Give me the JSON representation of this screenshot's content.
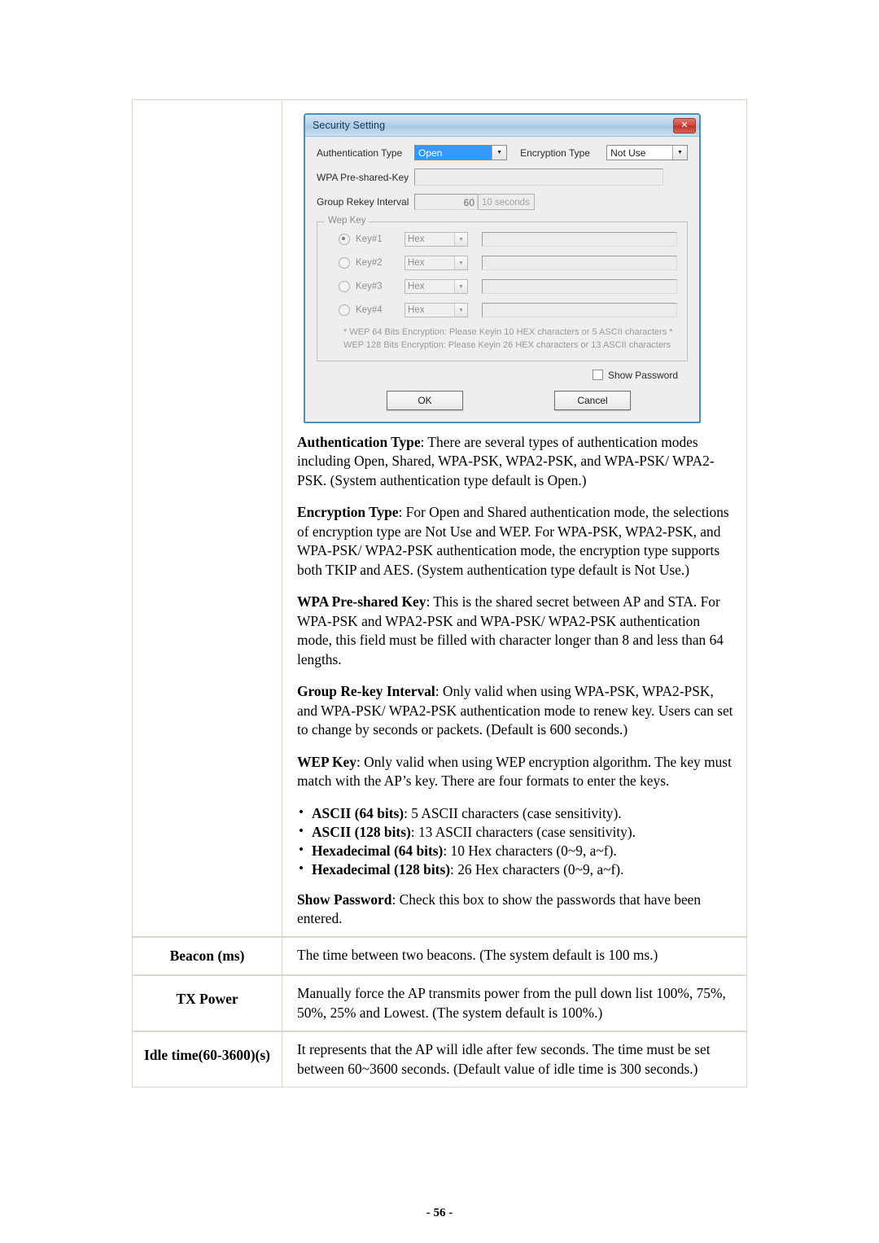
{
  "page": {
    "footer": "- 56 -"
  },
  "dialog": {
    "title": "Security Setting",
    "close_icon": "close-icon",
    "fields": {
      "auth_type_label": "Authentication Type",
      "auth_type_value": "Open",
      "encryption_type_label": "Encryption Type",
      "encryption_type_value": "Not Use",
      "wpa_psk_label": "WPA Pre-shared-Key",
      "wpa_psk_value": "",
      "group_rekey_label": "Group Rekey Interval",
      "group_rekey_value": "60",
      "group_rekey_unit": "10 seconds"
    },
    "wep": {
      "legend": "Wep Key",
      "keys": [
        {
          "name": "Key#1",
          "format": "Hex",
          "value": "",
          "selected": true
        },
        {
          "name": "Key#2",
          "format": "Hex",
          "value": "",
          "selected": false
        },
        {
          "name": "Key#3",
          "format": "Hex",
          "value": "",
          "selected": false
        },
        {
          "name": "Key#4",
          "format": "Hex",
          "value": "",
          "selected": false
        }
      ],
      "note_line1": "* WEP 64 Bits Encryption:  Please Keyin 10 HEX characters or 5 ASCII characters *",
      "note_line2": "WEP 128 Bits Encryption:  Please Keyin 26 HEX characters or 13 ASCII characters"
    },
    "show_password_label": "Show Password",
    "show_password_checked": false,
    "ok_label": "OK",
    "cancel_label": "Cancel"
  },
  "descriptions": {
    "auth_type": {
      "term": "Authentication Type",
      "text": ": There are several types of authentication modes including Open, Shared, WPA-PSK, WPA2-PSK, and WPA-PSK/ WPA2-PSK. (System authentication type default is Open.)"
    },
    "encryption_type": {
      "term": "Encryption Type",
      "plain": ": For Open and Shared authentication mode, the selections of encryption type are Not Use and WEP. For WPA-PSK, WPA2-PSK, and WPA-PSK/ WPA2-PSK authentication mode, the encryption type supports both TKIP and AES. (System authentication type default is Not Use.)"
    },
    "wpa_key": {
      "term": "WPA Pre-shared Key",
      "text": ": This is the shared secret between AP and STA. For WPA-PSK and WPA2-PSK and WPA-PSK/ WPA2-PSK authentication mode, this field must be filled with character longer than 8 and less than 64 lengths."
    },
    "group_rekey": {
      "term": "Group Re-key Interval",
      "text": ": Only valid when using WPA-PSK, WPA2-PSK, and WPA-PSK/ WPA2-PSK authentication mode to renew key. Users can set to change by seconds or packets. (Default is 600 seconds.)"
    },
    "wep_key": {
      "term": "WEP Key",
      "text": ": Only valid when using WEP encryption algorithm. The key must match with the AP’s key. There are four formats to enter the keys."
    },
    "wep_formats": [
      {
        "term": "ASCII (64 bits)",
        "text": ": 5 ASCII characters (case sensitivity)."
      },
      {
        "term": "ASCII (128 bits)",
        "text": ": 13 ASCII characters (case sensitivity)."
      },
      {
        "term": "Hexadecimal (64 bits)",
        "text": ": 10 Hex characters (0~9, a~f)."
      },
      {
        "term": "Hexadecimal (128 bits)",
        "text": ": 26 Hex characters (0~9, a~f)."
      }
    ],
    "show_password": {
      "term": "Show Password",
      "text": ": Check this box to show the passwords that have been entered."
    }
  },
  "table_rows": [
    {
      "label": "Beacon (ms)",
      "text": "The time between two beacons. (The system default is 100 ms.)"
    },
    {
      "label": "TX Power",
      "text": "Manually force the AP transmits power from the pull down list 100%, 75%, 50%, 25% and Lowest. (The system default is 100%.)"
    },
    {
      "label": "Idle time(60-3600)(s)",
      "text": "It represents that the AP will idle after few seconds. The time must be set between 60~3600 seconds. (Default value of idle time is 300 seconds.)"
    }
  ]
}
